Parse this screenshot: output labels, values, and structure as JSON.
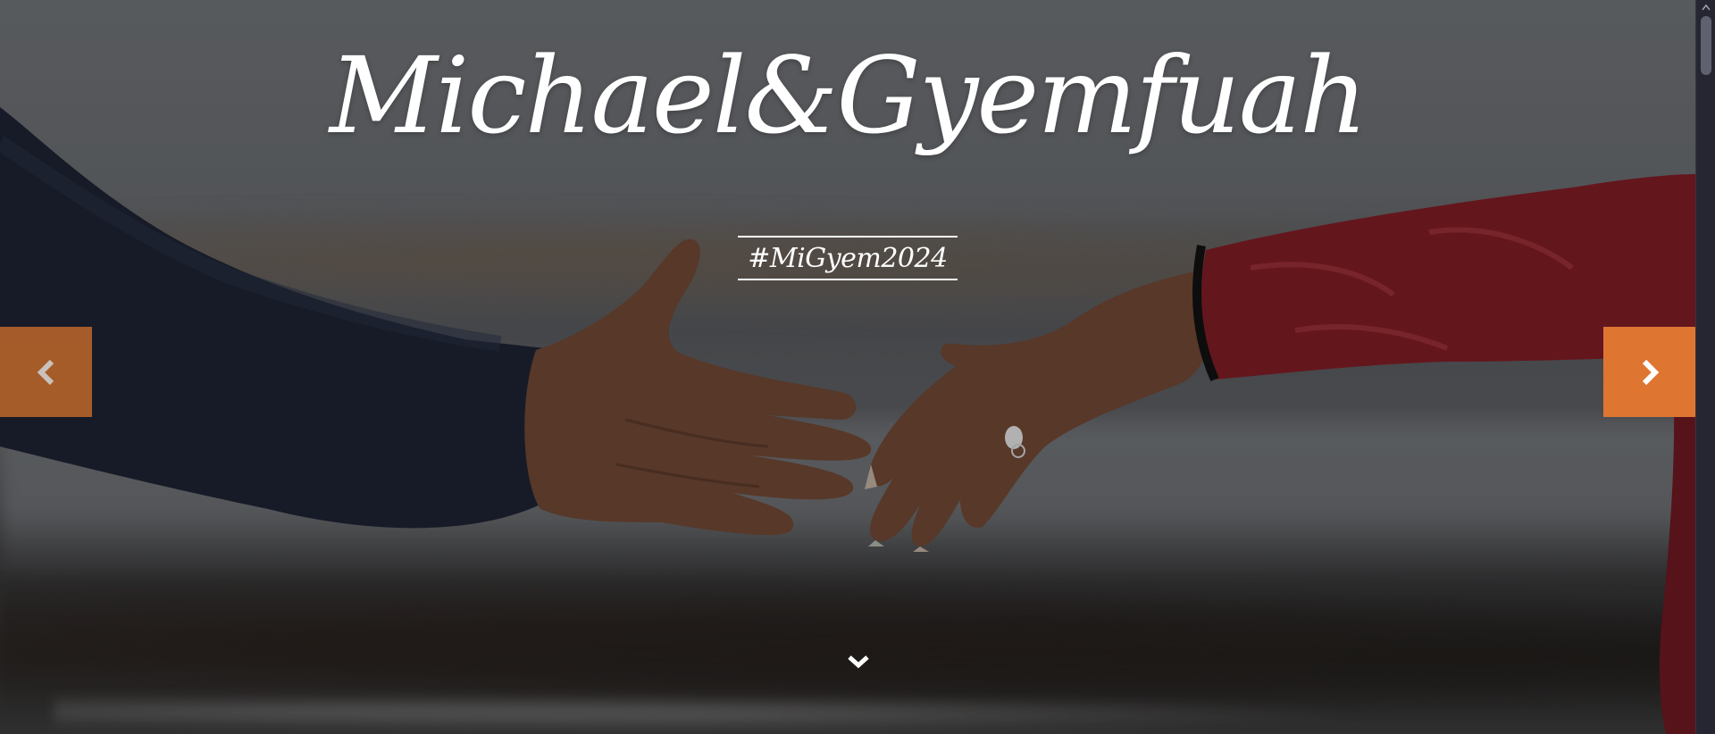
{
  "hero": {
    "couple_names": "Michael&Gyemfuah",
    "hashtag": "#MiGyem2024"
  },
  "carousel": {
    "prev_icon": "chevron-left-icon",
    "next_icon": "chevron-right-icon",
    "prev_color": "#b3622a",
    "next_color": "#de7632"
  },
  "scroll_indicator": {
    "icon": "chevron-down-icon"
  },
  "scrollbar": {
    "icon": "arrow-up-icon"
  }
}
